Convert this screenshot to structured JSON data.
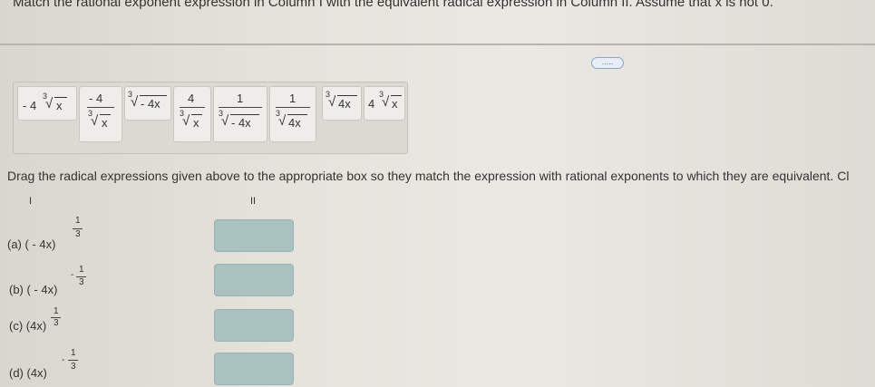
{
  "header": {
    "instruction": "Match the rational exponent expression in Column I with the equivalent radical expression in Column II. Assume that x is not 0.",
    "more_label": "....."
  },
  "tray": {
    "tiles": [
      {
        "coef": "- 4",
        "index": "3",
        "radicand": "x"
      },
      {
        "numerator": "- 4",
        "index": "3",
        "radicand": "x"
      },
      {
        "index": "3",
        "radicand": "- 4x"
      },
      {
        "numerator": "4",
        "index": "3",
        "radicand": "x"
      },
      {
        "numerator": "1",
        "index": "3",
        "radicand": "- 4x"
      },
      {
        "numerator": "1",
        "index": "3",
        "radicand": "4x"
      },
      {
        "index": "3",
        "radicand": "4x"
      },
      {
        "coef": "4",
        "index": "3",
        "radicand": "x"
      }
    ]
  },
  "instruction2": "Drag the radical expressions given above to the appropriate box so they match the expression with rational exponents to which they are equivalent. Cl",
  "columns": {
    "col1": "I",
    "col2": "II"
  },
  "items": [
    {
      "label": "(a) ( - 4x)",
      "exp_sign": "",
      "exp_num": "1",
      "exp_den": "3"
    },
    {
      "label": "(b) ( - 4x)",
      "exp_sign": "-",
      "exp_num": "1",
      "exp_den": "3"
    },
    {
      "label": "(c) (4x)",
      "exp_sign": "",
      "exp_num": "1",
      "exp_den": "3"
    },
    {
      "label": "(d) (4x)",
      "exp_sign": "-",
      "exp_num": "1",
      "exp_den": "3"
    }
  ],
  "colors": {
    "drop_box": "#a9c2bf",
    "tray": "#dcd9d3",
    "tile": "#efede9"
  }
}
